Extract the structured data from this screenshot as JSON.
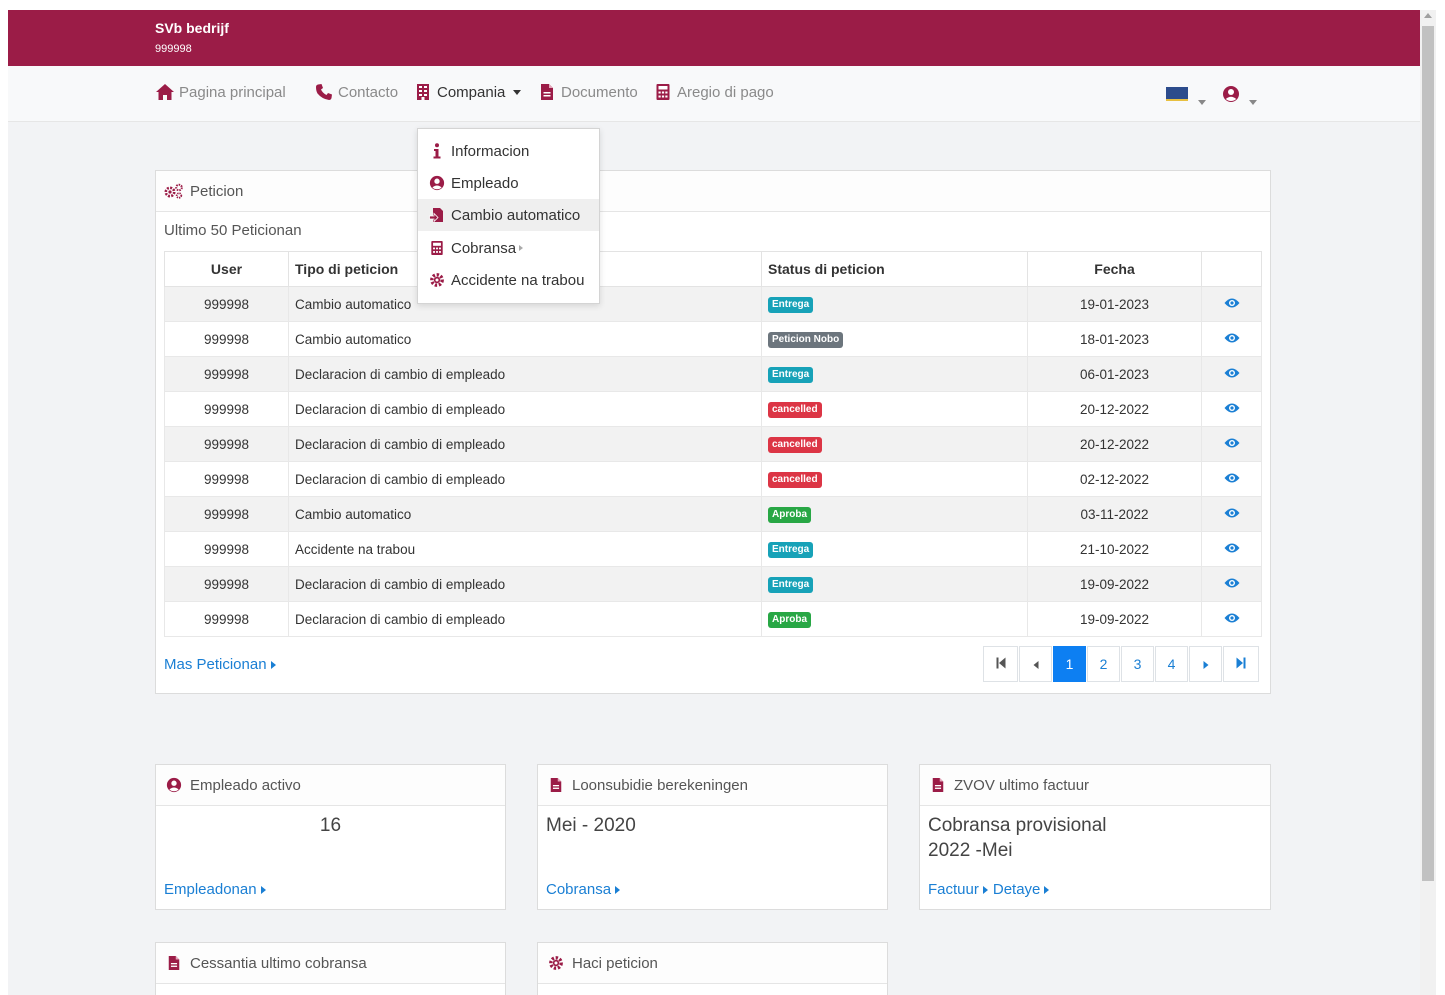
{
  "header": {
    "company": "SVb bedrijf",
    "id": "999998"
  },
  "nav": {
    "home": "Pagina principal",
    "contact": "Contacto",
    "company": "Compania",
    "document": "Documento",
    "payment": "Aregio di pago"
  },
  "dropdown": [
    {
      "label": "Informacion",
      "icon": "info-icon"
    },
    {
      "label": "Empleado",
      "icon": "user-circle-icon"
    },
    {
      "label": "Cambio automatico",
      "icon": "document-export-icon"
    },
    {
      "label": "Cobransa",
      "icon": "calculator-icon"
    },
    {
      "label": "Accidente na trabou",
      "icon": "gear-icon"
    }
  ],
  "requests": {
    "title": "Peticion",
    "subtitle": "Ultimo 50 Peticionan",
    "columns": [
      "User",
      "Tipo di peticion",
      "Status di peticion",
      "Fecha",
      ""
    ],
    "rows": [
      {
        "user": "999998",
        "type": "Cambio automatico",
        "status": "Entrega",
        "date": "19-01-2023"
      },
      {
        "user": "999998",
        "type": "Cambio automatico",
        "status": "Peticion Nobo",
        "date": "18-01-2023"
      },
      {
        "user": "999998",
        "type": "Declaracion di cambio di empleado",
        "status": "Entrega",
        "date": "06-01-2023"
      },
      {
        "user": "999998",
        "type": "Declaracion di cambio di empleado",
        "status": "cancelled",
        "date": "20-12-2022"
      },
      {
        "user": "999998",
        "type": "Declaracion di cambio di empleado",
        "status": "cancelled",
        "date": "20-12-2022"
      },
      {
        "user": "999998",
        "type": "Declaracion di cambio di empleado",
        "status": "cancelled",
        "date": "02-12-2022"
      },
      {
        "user": "999998",
        "type": "Cambio automatico",
        "status": "Aproba",
        "date": "03-11-2022"
      },
      {
        "user": "999998",
        "type": "Accidente na trabou",
        "status": "Entrega",
        "date": "21-10-2022"
      },
      {
        "user": "999998",
        "type": "Declaracion di cambio di empleado",
        "status": "Entrega",
        "date": "19-09-2022"
      },
      {
        "user": "999998",
        "type": "Declaracion di cambio di empleado",
        "status": "Aproba",
        "date": "19-09-2022"
      }
    ],
    "more_link": "Mas Peticionan",
    "pages": [
      "1",
      "2",
      "3",
      "4"
    ],
    "current_page": "1"
  },
  "status_colors": {
    "Entrega": "#17a2b8",
    "Peticion Nobo": "#6c757d",
    "cancelled": "#dc3545",
    "Aproba": "#28a745"
  },
  "summary": {
    "employees": {
      "title": "Empleado activo",
      "value": "16",
      "link": "Empleadonan"
    },
    "loonsubsidie": {
      "title": "Loonsubidie berekeningen",
      "value": "Mei - 2020",
      "link": "Cobransa"
    },
    "zvov": {
      "title": "ZVOV ultimo factuur",
      "value1": "Cobransa provisional",
      "value2": "2022 -Mei",
      "link1": "Factuur",
      "link2": "Detaye"
    },
    "cessantia": {
      "title": "Cessantia ultimo cobransa"
    },
    "haci": {
      "title": "Haci peticion"
    }
  },
  "colors": {
    "brand": "#9b1c47",
    "accent": "#1a7fd4"
  }
}
